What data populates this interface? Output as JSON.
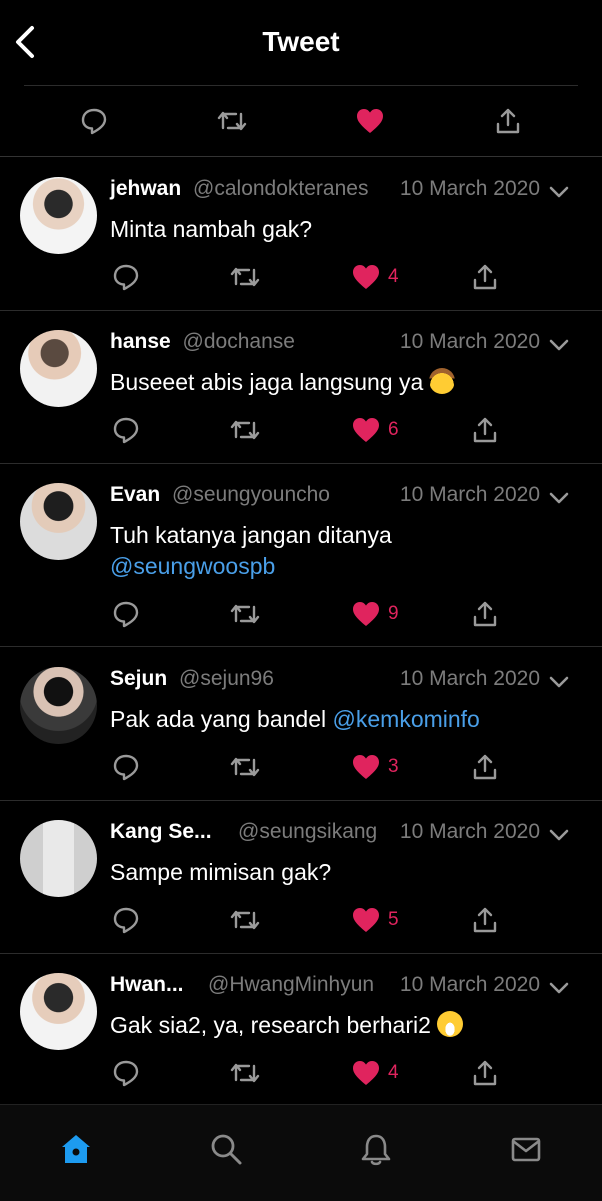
{
  "header": {
    "title": "Tweet",
    "back_icon": "back-chevron-icon"
  },
  "top_actions": [
    "reply-icon",
    "retweet-icon",
    "like-icon-filled",
    "share-icon"
  ],
  "colors": {
    "like": "#e0245e",
    "mention": "#4a9fe8",
    "muted": "#7c7c7c",
    "active_nav": "#1d9bf0"
  },
  "tweets": [
    {
      "name": "jehwan",
      "handle": "@calondokteranes",
      "date": "10 March 2020",
      "text": "Minta nambah gak?",
      "likes": "4"
    },
    {
      "name": "hanse",
      "handle": "@dochanse",
      "date": "10 March 2020",
      "text": "Buseeet abis jaga langsung ya",
      "emoji": "cowboy-face-emoji",
      "likes": "6"
    },
    {
      "name": "Evan",
      "handle": "@seungyouncho",
      "date": "10 March 2020",
      "text": "Tuh katanya jangan ditanya",
      "mention": "@seungwoospb",
      "likes": "9"
    },
    {
      "name": "Sejun",
      "handle": "@sejun96",
      "date": "10 March 2020",
      "text": "Pak ada yang bandel",
      "mention": "@kemkominfo",
      "likes": "3"
    },
    {
      "name": "Kang Se...",
      "handle": "@seungsikang",
      "date": "10 March 2020",
      "text": "Sampe mimisan gak?",
      "likes": "5"
    },
    {
      "name": "Hwan...",
      "handle": "@HwangMinhyun",
      "date": "10 March 2020",
      "text": "Gak sia2, ya, research berhari2",
      "emoji": "grinning-face-emoji",
      "likes": "4"
    }
  ],
  "bottom_nav": [
    "home-icon",
    "search-icon",
    "notifications-bell-icon",
    "messages-mail-icon"
  ]
}
